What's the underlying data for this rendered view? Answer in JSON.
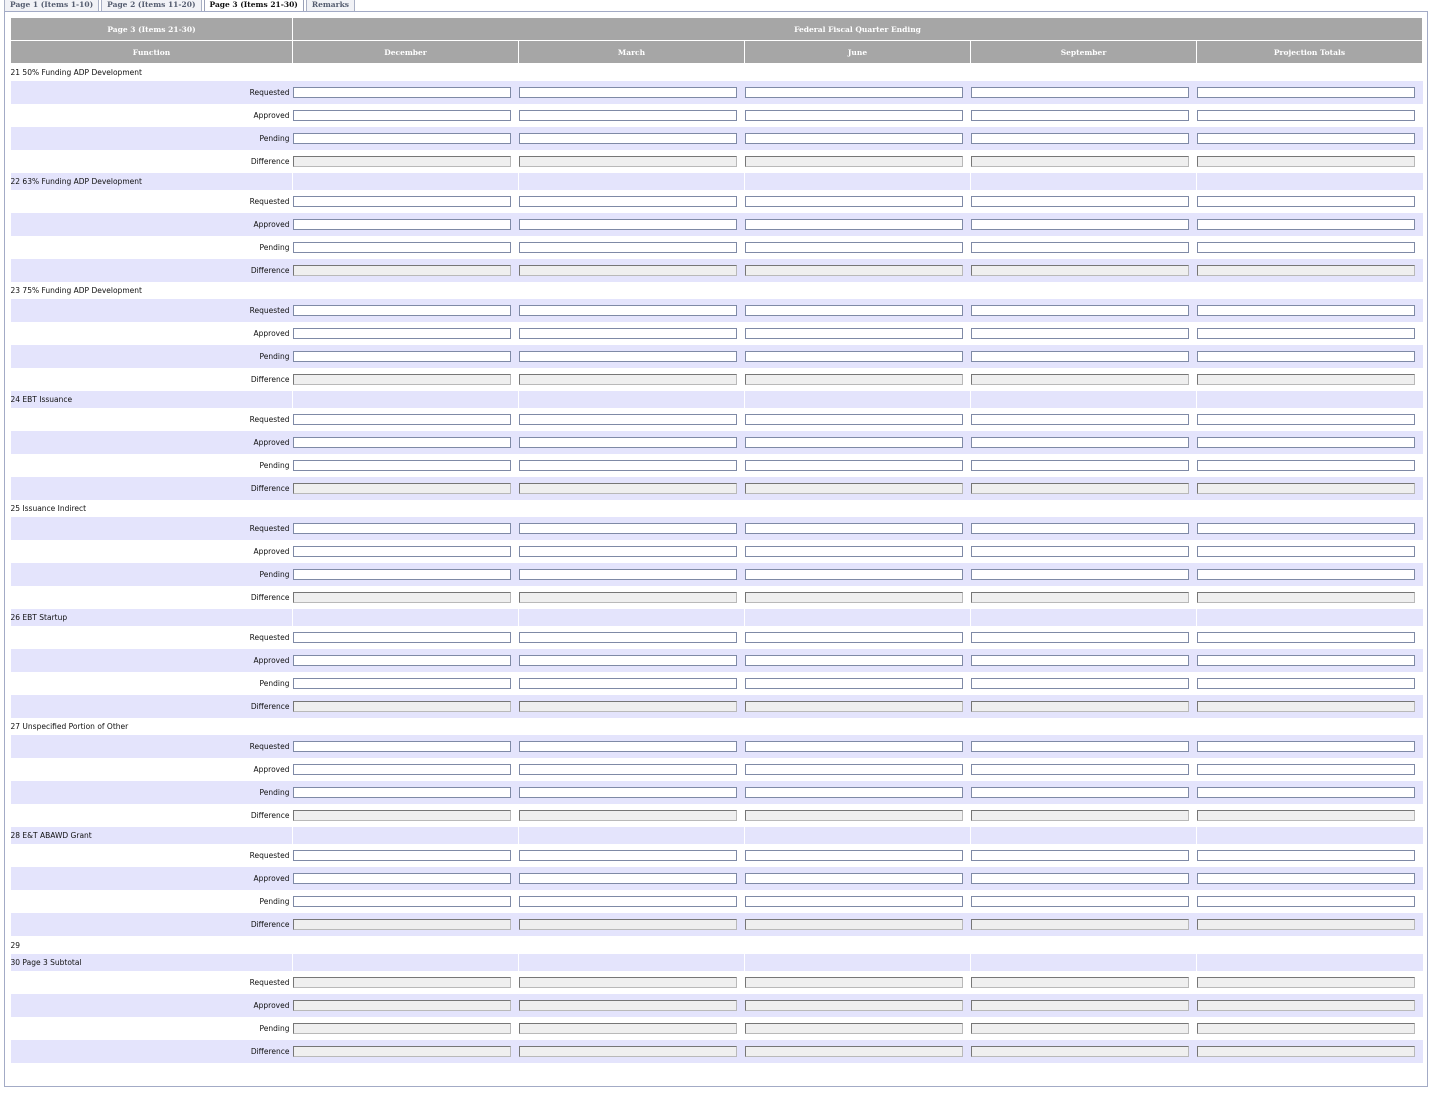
{
  "tabs": [
    {
      "label": "Page 1 (Items 1-10)",
      "active": false
    },
    {
      "label": "Page 2 (Items 11-20)",
      "active": false
    },
    {
      "label": "Page 3 (Items 21-30)",
      "active": true
    },
    {
      "label": "Remarks",
      "active": false
    }
  ],
  "header": {
    "page_title": "Page 3 (Items 21-30)",
    "fiscal_title": "Federal Fiscal Quarter Ending",
    "function_label": "Function",
    "columns": [
      "December",
      "March",
      "June",
      "September",
      "Projection Totals"
    ]
  },
  "groups": [
    {
      "title": "21 50% Funding ADP Development",
      "rows": [
        {
          "label": "Requested",
          "readonly": false
        },
        {
          "label": "Approved",
          "readonly": false
        },
        {
          "label": "Pending",
          "readonly": false
        },
        {
          "label": "Difference",
          "readonly": true
        }
      ]
    },
    {
      "title": "22 63% Funding ADP Development",
      "rows": [
        {
          "label": "Requested",
          "readonly": false
        },
        {
          "label": "Approved",
          "readonly": false
        },
        {
          "label": "Pending",
          "readonly": false
        },
        {
          "label": "Difference",
          "readonly": true
        }
      ]
    },
    {
      "title": "23 75% Funding ADP Development",
      "rows": [
        {
          "label": "Requested",
          "readonly": false
        },
        {
          "label": "Approved",
          "readonly": false
        },
        {
          "label": "Pending",
          "readonly": false
        },
        {
          "label": "Difference",
          "readonly": true
        }
      ]
    },
    {
      "title": "24 EBT Issuance",
      "rows": [
        {
          "label": "Requested",
          "readonly": false
        },
        {
          "label": "Approved",
          "readonly": false
        },
        {
          "label": "Pending",
          "readonly": false
        },
        {
          "label": "Difference",
          "readonly": true
        }
      ]
    },
    {
      "title": "25 Issuance Indirect",
      "rows": [
        {
          "label": "Requested",
          "readonly": false
        },
        {
          "label": "Approved",
          "readonly": false
        },
        {
          "label": "Pending",
          "readonly": false
        },
        {
          "label": "Difference",
          "readonly": true
        }
      ]
    },
    {
      "title": "26 EBT Startup",
      "rows": [
        {
          "label": "Requested",
          "readonly": false
        },
        {
          "label": "Approved",
          "readonly": false
        },
        {
          "label": "Pending",
          "readonly": false
        },
        {
          "label": "Difference",
          "readonly": true
        }
      ]
    },
    {
      "title": "27 Unspecified Portion of Other",
      "rows": [
        {
          "label": "Requested",
          "readonly": false
        },
        {
          "label": "Approved",
          "readonly": false
        },
        {
          "label": "Pending",
          "readonly": false
        },
        {
          "label": "Difference",
          "readonly": true
        }
      ]
    },
    {
      "title": "28 E&T ABAWD Grant",
      "rows": [
        {
          "label": "Requested",
          "readonly": false
        },
        {
          "label": "Approved",
          "readonly": false
        },
        {
          "label": "Pending",
          "readonly": false
        },
        {
          "label": "Difference",
          "readonly": true
        }
      ]
    },
    {
      "title": "29",
      "blank": true,
      "rows": []
    },
    {
      "title": "30 Page 3 Subtotal",
      "rows": [
        {
          "label": "Requested",
          "readonly": true
        },
        {
          "label": "Approved",
          "readonly": true
        },
        {
          "label": "Pending",
          "readonly": true
        },
        {
          "label": "Difference",
          "readonly": true
        }
      ]
    }
  ]
}
